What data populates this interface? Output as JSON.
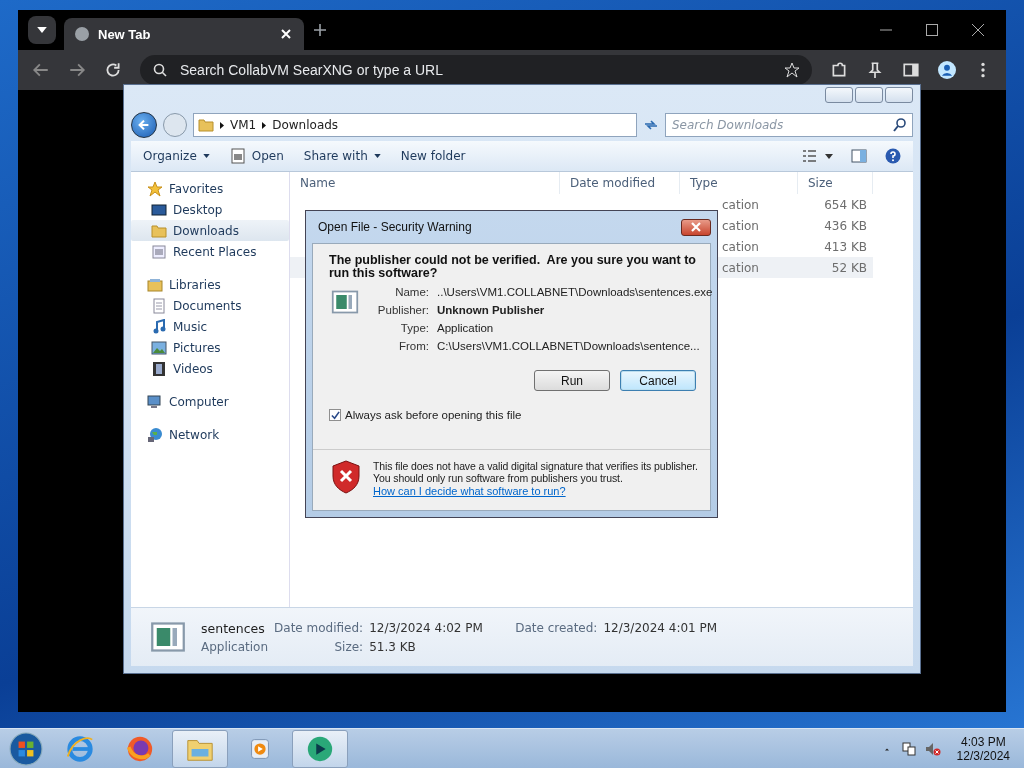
{
  "browser": {
    "tabs": [
      {
        "title": "New Tab",
        "selected": true
      }
    ],
    "address_bar": {
      "placeholder": "Search CollabVM SearXNG or type a URL"
    }
  },
  "explorer": {
    "breadcrumb": [
      "VM1",
      "Downloads"
    ],
    "search": {
      "placeholder": "Search Downloads"
    },
    "toolbar": [
      {
        "label": "Organize",
        "menu": true
      },
      {
        "label": "Open",
        "menu": false
      },
      {
        "label": "Share with",
        "menu": true
      },
      {
        "label": "New folder",
        "menu": false
      }
    ],
    "nav": [
      {
        "label": "Favorites",
        "selected": false,
        "children": [
          {
            "label": "Desktop",
            "selected": false
          },
          {
            "label": "Downloads",
            "selected": true
          },
          {
            "label": "Recent Places",
            "selected": false
          }
        ]
      },
      {
        "label": "Libraries",
        "selected": false,
        "children": [
          {
            "label": "Documents",
            "selected": false
          },
          {
            "label": "Music",
            "selected": false
          },
          {
            "label": "Pictures",
            "selected": false
          },
          {
            "label": "Videos",
            "selected": false
          }
        ]
      },
      {
        "label": "Computer",
        "selected": false
      },
      {
        "label": "Network",
        "selected": false
      }
    ],
    "columns": [
      "Name",
      "Date modified",
      "Type",
      "Size"
    ],
    "rows": [
      {
        "type": "cation",
        "size": "654 KB",
        "selected": false
      },
      {
        "type": "cation",
        "size": "436 KB",
        "selected": false
      },
      {
        "type": "cation",
        "size": "413 KB",
        "selected": false
      },
      {
        "type": "cation",
        "size": "52 KB",
        "selected": true
      }
    ],
    "details": {
      "name": "sentences",
      "type": "Application",
      "fields": [
        {
          "label": "Date modified:",
          "value": "12/3/2024 4:02 PM"
        },
        {
          "label": "Size:",
          "value": "51.3 KB"
        },
        {
          "label": "Date created:",
          "value": "12/3/2024 4:01 PM"
        }
      ]
    }
  },
  "dialog": {
    "title": "Open File - Security Warning",
    "heading": "The publisher could not be verified.  Are you sure you want to run this software?",
    "fields": [
      {
        "label": "Name:",
        "value": "..\\Users\\VM1.COLLABNET\\Downloads\\sentences.exe",
        "bold": false
      },
      {
        "label": "Publisher:",
        "value": "Unknown Publisher",
        "bold": true
      },
      {
        "label": "Type:",
        "value": "Application",
        "bold": false
      },
      {
        "label": "From:",
        "value": "C:\\Users\\VM1.COLLABNET\\Downloads\\sentence...",
        "bold": false
      }
    ],
    "buttons": [
      {
        "label": "Run",
        "default": false
      },
      {
        "label": "Cancel",
        "default": true
      }
    ],
    "checkbox": {
      "label": "Always ask before opening this file",
      "checked": true
    },
    "warning": "This file does not have a valid digital signature that verifies its publisher.  You should only run software from publishers you trust.",
    "link": "How can I decide what software to run?"
  },
  "taskbar": {
    "apps": [
      {
        "kind": "ie",
        "selected": false
      },
      {
        "kind": "firefox",
        "selected": false
      },
      {
        "kind": "explorer",
        "selected": true
      },
      {
        "kind": "media",
        "selected": false
      },
      {
        "kind": "collab",
        "selected": true
      }
    ],
    "time": "4:03 PM",
    "date": "12/3/2024"
  }
}
